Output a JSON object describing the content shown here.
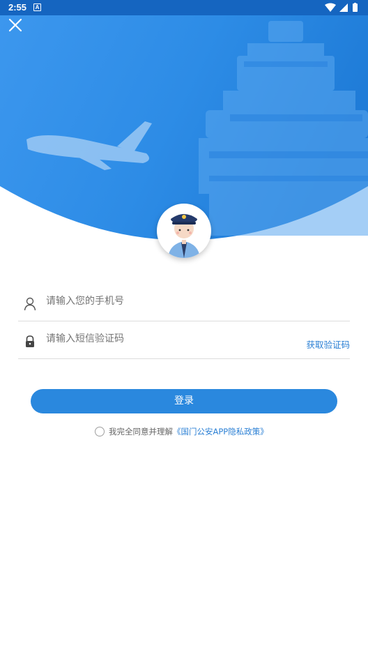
{
  "status_bar": {
    "time": "2:55",
    "notification_icon": "a-icon",
    "indicators": [
      "wifi-icon",
      "signal-icon",
      "battery-icon"
    ]
  },
  "header": {
    "close_icon": "close-icon",
    "background_image": "airport-control-tower-and-airplane",
    "avatar_image": "police-officer-avatar",
    "colors": {
      "primary_blue": "#2a88de",
      "header_blue": "#2f8ee6"
    }
  },
  "form": {
    "phone_placeholder": "请输入您的手机号",
    "code_placeholder": "请输入短信验证码",
    "get_code_label": "获取验证码",
    "login_label": "登录"
  },
  "agreement": {
    "text": "我完全同意并理解",
    "link": "《国门公安APP隐私政策》",
    "checked": false
  }
}
